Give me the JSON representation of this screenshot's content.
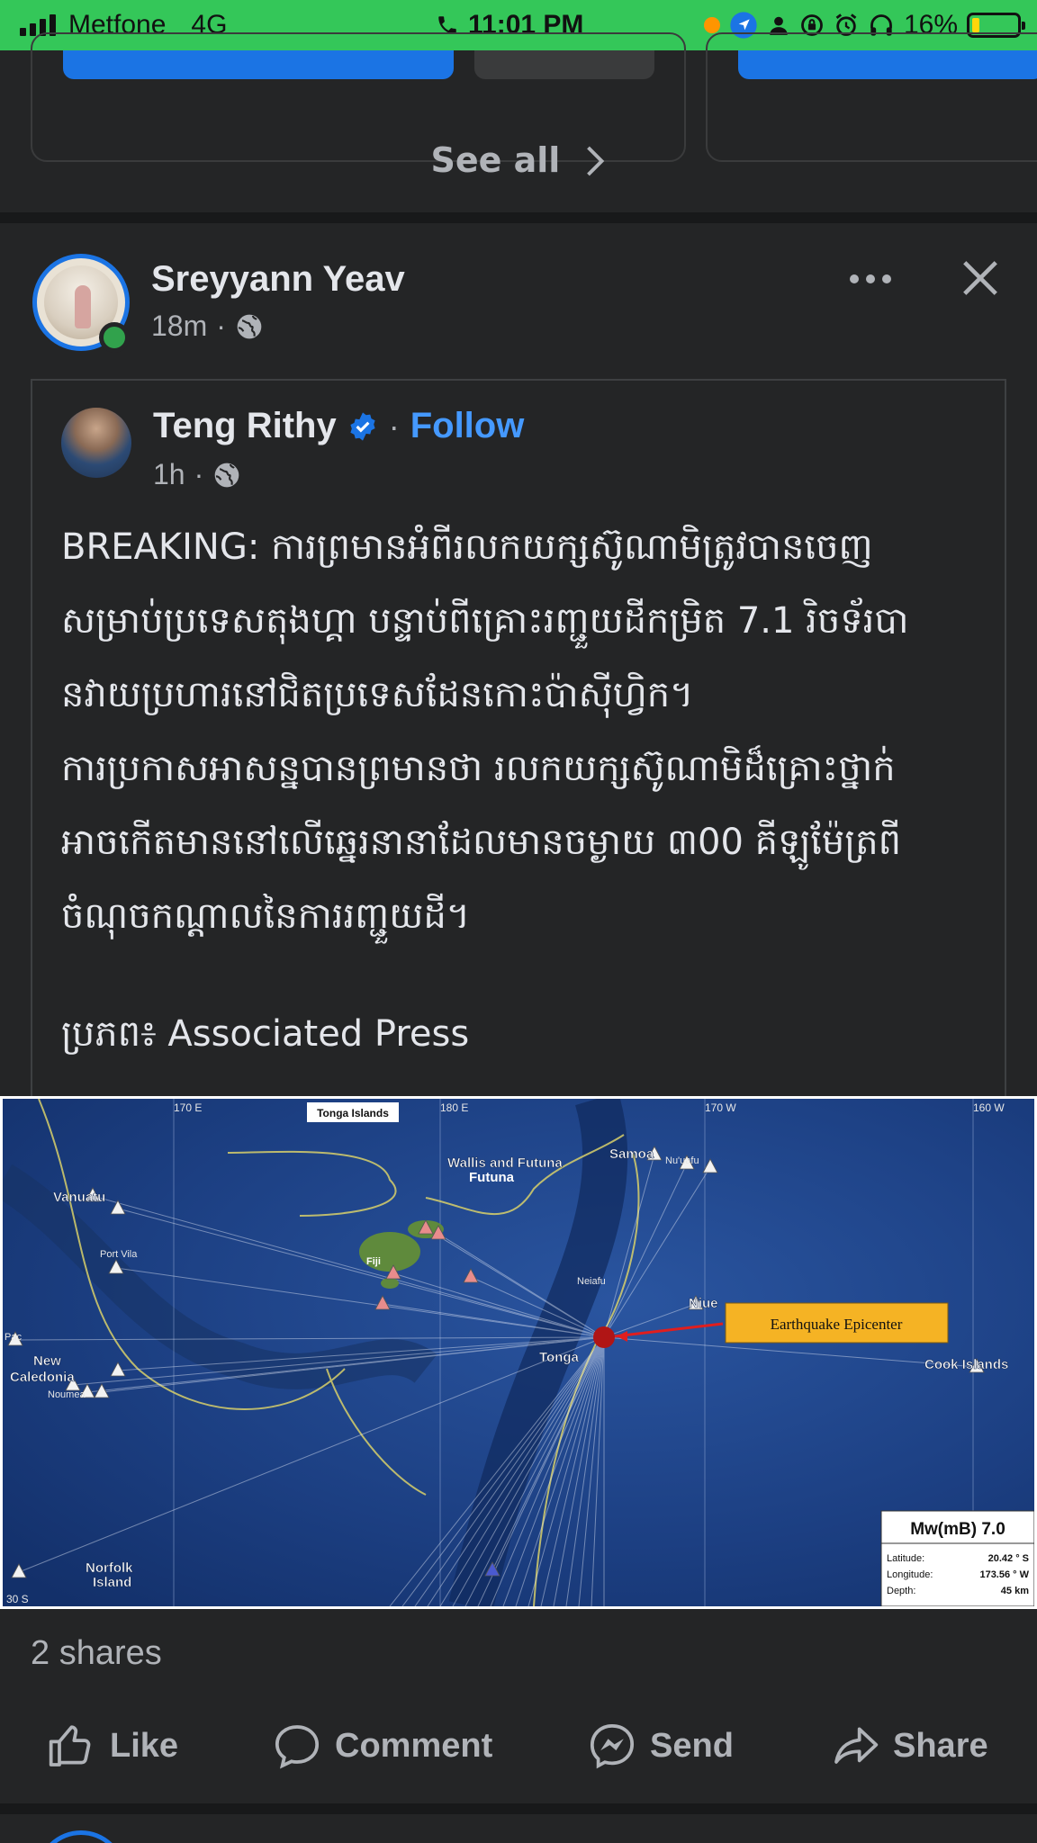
{
  "status_bar": {
    "carrier": "Metfone",
    "network": "4G",
    "time": "11:01 PM",
    "battery": "16%",
    "battery_level": 0.16,
    "signal_bars": 4
  },
  "top": {
    "see_all": "See all"
  },
  "post": {
    "author": "Sreyyann Yeav",
    "time": "18m",
    "audience_icon": "globe-icon",
    "shared": {
      "author": "Teng Rithy",
      "verified": true,
      "follow_label": "Follow",
      "time": "1h",
      "text_lines": [
        "BREAKING: ការព្រមានអំពីរលកយក្សស៊ូណាមិត្រូវបានចេញ",
        "សម្រាប់ប្រទេសតុងហ្គា បន្ទាប់ពីគ្រោះរញ្ជួយដីកម្រិត 7.1 រិចទ័របា",
        "នវាយប្រហារនៅជិតប្រទេសដែនកោះប៉ាស៊ីហ្វិក។",
        "ការប្រកាសអាសន្នបានព្រមានថា រលកយក្សស៊ូណាមិដ៏គ្រោះថ្នាក់",
        "អាចកើតមាននៅលើឆ្នេរនានាដែលមានចម្ងាយ ៣00 គីឡូម៉ែត្រពី",
        "ចំណុចកណ្តាលនៃការរញ្ជួយដី។"
      ],
      "source": "ប្រភព៖ Associated Press"
    },
    "map": {
      "title": "Tonga Islands",
      "longitudes": [
        "170 E",
        "180 E",
        "170 W",
        "160 W"
      ],
      "latitude_label": "30 S",
      "places": {
        "wallis_futuna": "Wallis and Futuna",
        "samoa": "Samoa",
        "niuafou": "Nu'uafu",
        "vanuatu": "Vanuatu",
        "port_vila": "Port Vila",
        "fiji": "Fiji",
        "neiafu": "Neiafu",
        "niue": "Niue",
        "tonga": "Tonga",
        "new_caledonia_1": "New",
        "new_caledonia_2": "Caledonia",
        "noumea": "Noumea",
        "norfolk_1": "Norfolk",
        "norfolk_2": "Island",
        "cook_islands": "Cook Islands",
        "pac": "Pac"
      },
      "epicenter_label": "Earthquake Epicenter",
      "magnitude": "Mw(mB) 7.0",
      "info": [
        {
          "label": "Latitude:",
          "value": "20.42 ° S"
        },
        {
          "label": "Longitude:",
          "value": "173.56 ° W"
        },
        {
          "label": "Depth:",
          "value": "45 km"
        }
      ]
    },
    "shares": "2 shares",
    "actions": [
      {
        "label": "Like",
        "icon": "thumbs-up-icon"
      },
      {
        "label": "Comment",
        "icon": "comment-icon"
      },
      {
        "label": "Send",
        "icon": "messenger-icon"
      },
      {
        "label": "Share",
        "icon": "share-icon"
      }
    ]
  }
}
